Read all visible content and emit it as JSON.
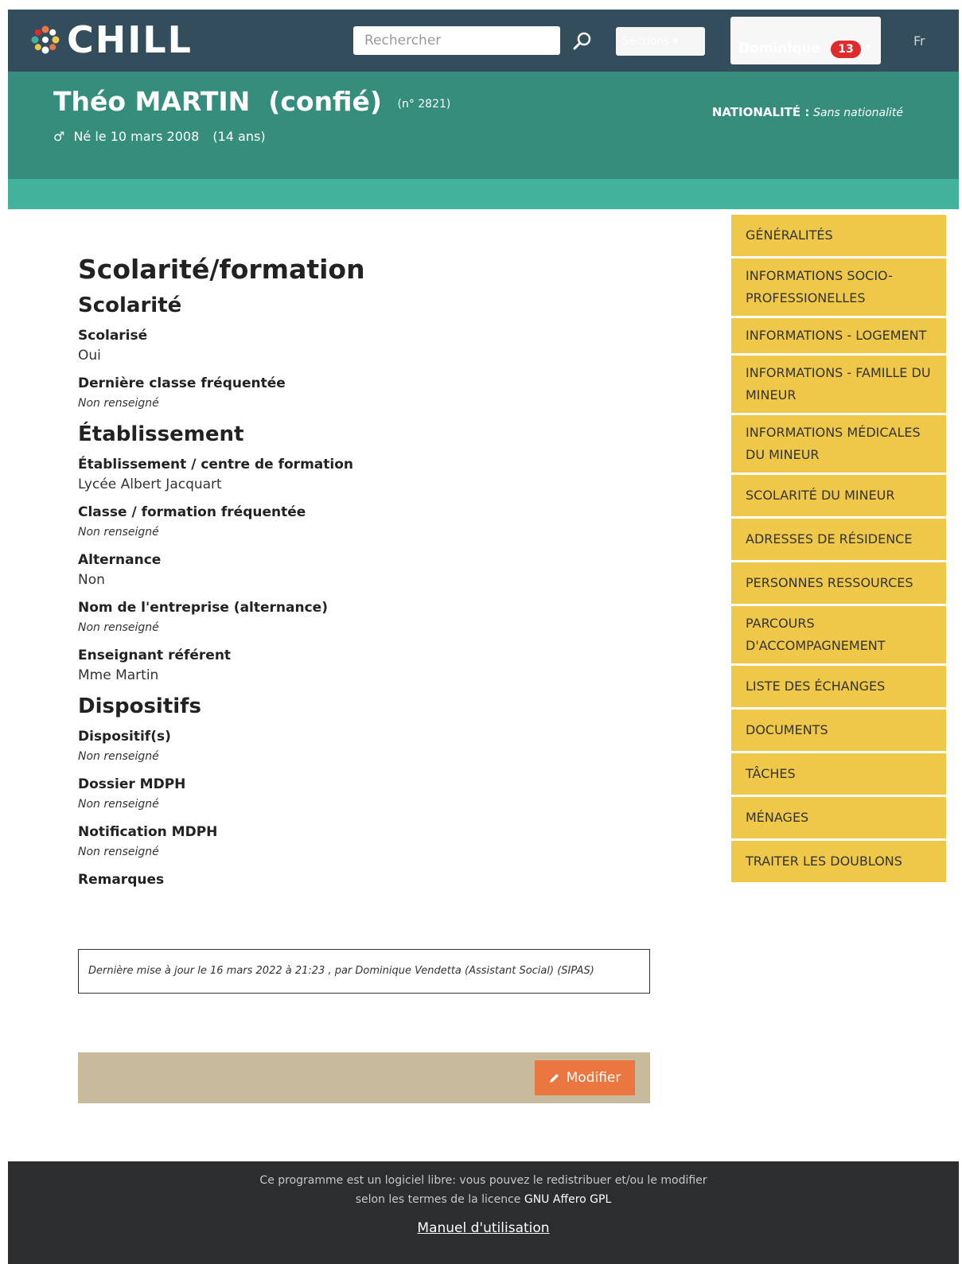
{
  "header": {
    "logo_text": "CHILL",
    "search_placeholder": "Rechercher",
    "menu_label": "Sections",
    "user_name": "Dominique",
    "notification_count": "13",
    "language": "Fr"
  },
  "person": {
    "name": "Théo MARTIN",
    "status": "(confié)",
    "number": "(n° 2821)",
    "gender_icon": "male-icon",
    "birth": "Né le 10 mars 2008",
    "age": "(14 ans)",
    "nationality_label": "NATIONALITÉ :",
    "nationality_value": "Sans nationalité"
  },
  "page": {
    "title": "Scolarité/formation",
    "sections": [
      {
        "heading": "Scolarité"
      },
      {
        "heading": "Établissement"
      },
      {
        "heading": "Dispositifs"
      }
    ],
    "fields": {
      "scolarise": {
        "label": "Scolarisé",
        "value": "Oui"
      },
      "derniere_classe": {
        "label": "Dernière classe fréquentée",
        "value": "Non renseigné"
      },
      "etablissement": {
        "label": "Établissement / centre de formation",
        "value": "Lycée Albert Jacquart"
      },
      "classe_formation": {
        "label": "Classe / formation fréquentée",
        "value": "Non renseigné"
      },
      "alternance": {
        "label": "Alternance",
        "value": "Non"
      },
      "entreprise": {
        "label": "Nom de l'entreprise (alternance)",
        "value": "Non renseigné"
      },
      "enseignant": {
        "label": "Enseignant référent",
        "value": "Mme Martin"
      },
      "dispositifs": {
        "label": "Dispositif(s)",
        "value": "Non renseigné"
      },
      "dossier_mdph": {
        "label": "Dossier MDPH",
        "value": "Non renseigné"
      },
      "notification_mdph": {
        "label": "Notification MDPH",
        "value": "Non renseigné"
      },
      "remarques": {
        "label": "Remarques"
      }
    },
    "last_update": "Dernière mise à jour le 16 mars 2022 à 21:23 , par Dominique Vendetta (Assistant Social) (SIPAS)",
    "edit_button": "Modifier",
    "edit_icon": "pencil-icon"
  },
  "sidebar": {
    "items": [
      {
        "label": "Généralités"
      },
      {
        "label": "Informations socio-professionelles"
      },
      {
        "label": "Informations - logement"
      },
      {
        "label": "Informations - famille du mineur"
      },
      {
        "label": "Informations médicales du mineur"
      },
      {
        "label": "Scolarité du mineur"
      },
      {
        "label": "Adresses de résidence"
      },
      {
        "label": "Personnes ressources"
      },
      {
        "label": "Parcours d'accompagnement"
      },
      {
        "label": "Liste des échanges"
      },
      {
        "label": "Documents"
      },
      {
        "label": "Tâches"
      },
      {
        "label": "Ménages"
      },
      {
        "label": "Traiter les doublons"
      }
    ]
  },
  "footer": {
    "line1": "Ce programme est un logiciel libre: vous pouvez le redistribuer et/ou le modifier",
    "line2_prefix": "selon les termes de la licence",
    "license": "GNU Affero GPL",
    "manual_link": "Manuel d'utilisation"
  },
  "colors": {
    "topbar": "#334d5c",
    "banner": "#358e7b",
    "banner_strip": "#43b29d",
    "sidebar_item": "#efc84a",
    "actions_bar": "#c8bb9d",
    "edit_button": "#e9773f",
    "footer": "#2b2d2f",
    "badge": "#df2b2b"
  }
}
